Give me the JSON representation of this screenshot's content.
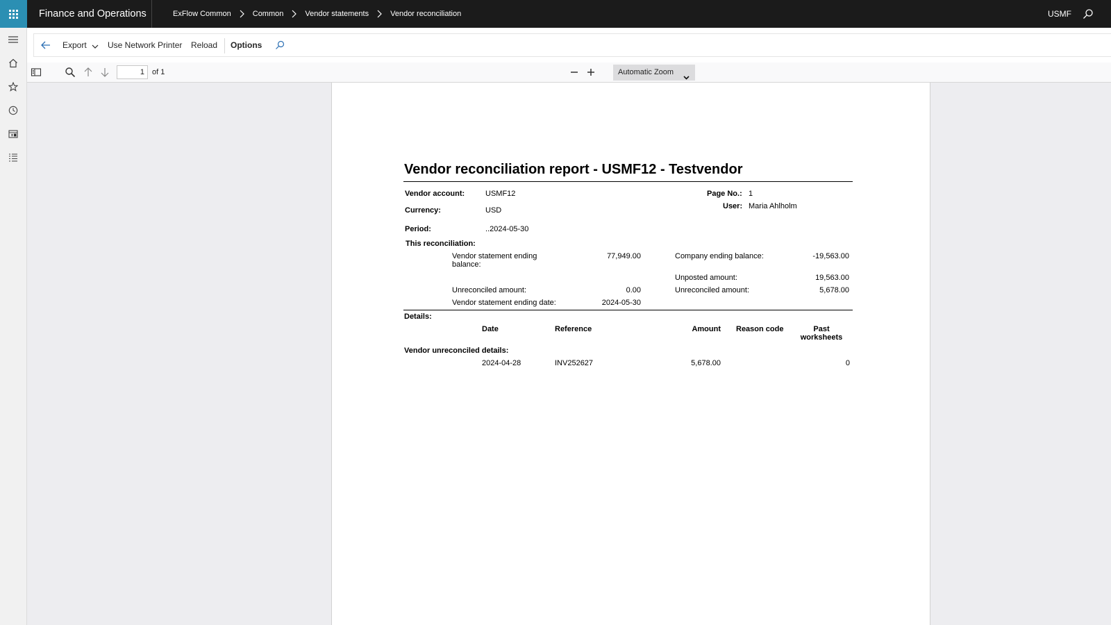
{
  "topbar": {
    "app_title": "Finance and Operations",
    "breadcrumb": [
      "ExFlow Common",
      "Common",
      "Vendor statements",
      "Vendor reconciliation"
    ],
    "company": "USMF"
  },
  "action_pane": {
    "export_label": "Export",
    "network_printer_label": "Use Network Printer",
    "reload_label": "Reload",
    "options_label": "Options"
  },
  "pdf_toolbar": {
    "page_number": "1",
    "page_of": "of 1",
    "zoom": "Automatic Zoom"
  },
  "report": {
    "title": "Vendor reconciliation report - USMF12 - Testvendor",
    "vendor_account_label": "Vendor account:",
    "vendor_account": "USMF12",
    "currency_label": "Currency:",
    "currency": "USD",
    "period_label": "Period:",
    "period": "..2024-05-30",
    "page_no_label": "Page No.:",
    "page_no": "1",
    "user_label": "User:",
    "user": "Maria Ahlholm",
    "this_reconciliation_label": "This reconciliation:",
    "vendor_ending_balance_label_1": "Vendor statement ending",
    "vendor_ending_balance_label_2": "balance:",
    "vendor_ending_balance": "77,949.00",
    "unreconciled_amount_label": "Unreconciled amount:",
    "unreconciled_amount": "0.00",
    "vendor_ending_date_label": "Vendor statement ending date:",
    "vendor_ending_date": "2024-05-30",
    "company_ending_balance_label": "Company ending balance:",
    "company_ending_balance": "-19,563.00",
    "unposted_amount_label": "Unposted amount:",
    "unposted_amount": "19,563.00",
    "company_unreconciled_label": "Unreconciled amount:",
    "company_unreconciled": "5,678.00",
    "details_label": "Details:",
    "columns": {
      "date": "Date",
      "reference": "Reference",
      "amount": "Amount",
      "reason_code": "Reason code",
      "past_worksheets_1": "Past",
      "past_worksheets_2": "worksheets"
    },
    "vendor_unreconciled_label": "Vendor unreconciled details:",
    "rows": [
      {
        "date": "2024-04-28",
        "reference": "INV252627",
        "amount": "5,678.00",
        "reason_code": "",
        "past_worksheets": "0"
      }
    ]
  }
}
